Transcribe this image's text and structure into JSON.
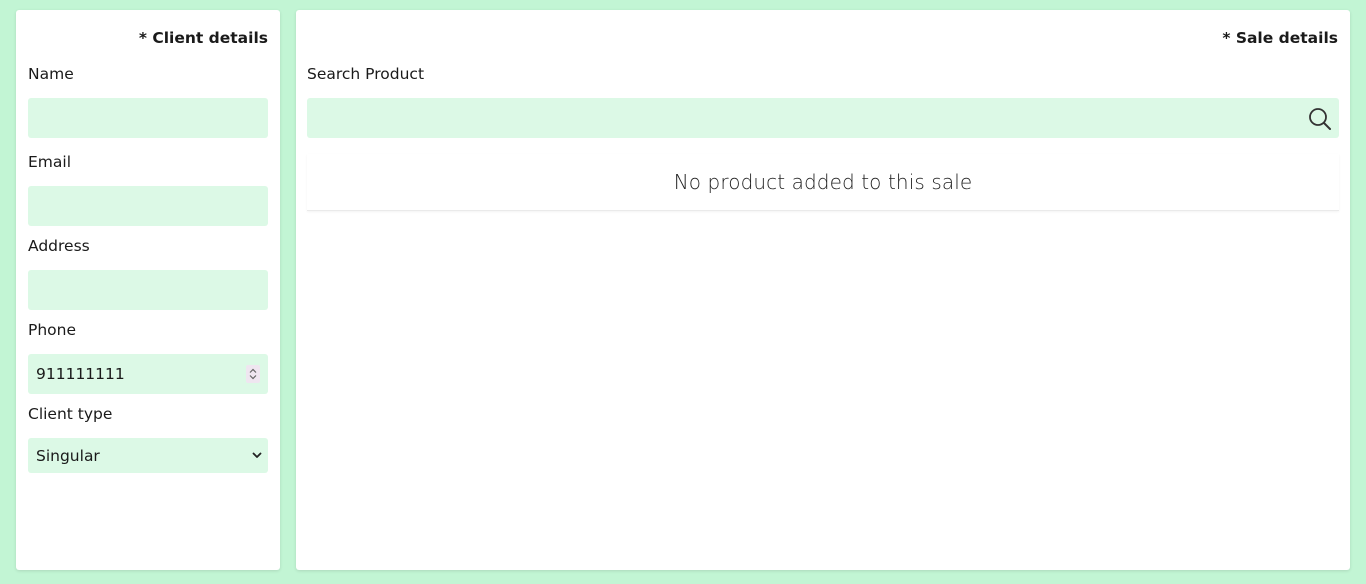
{
  "client": {
    "title": "* Client details",
    "name_label": "Name",
    "name_value": "",
    "email_label": "Email",
    "email_value": "",
    "address_label": "Address",
    "address_value": "",
    "phone_label": "Phone",
    "phone_value": "911111111",
    "type_label": "Client type",
    "type_selected": "Singular"
  },
  "sale": {
    "title": "* Sale details",
    "search_label": "Search Product",
    "search_value": "",
    "search_icon": "search-icon",
    "empty_message": "No product added to this sale"
  },
  "colors": {
    "background": "#c2f5d4",
    "field_background": "#dcf9e6",
    "panel": "#ffffff"
  }
}
